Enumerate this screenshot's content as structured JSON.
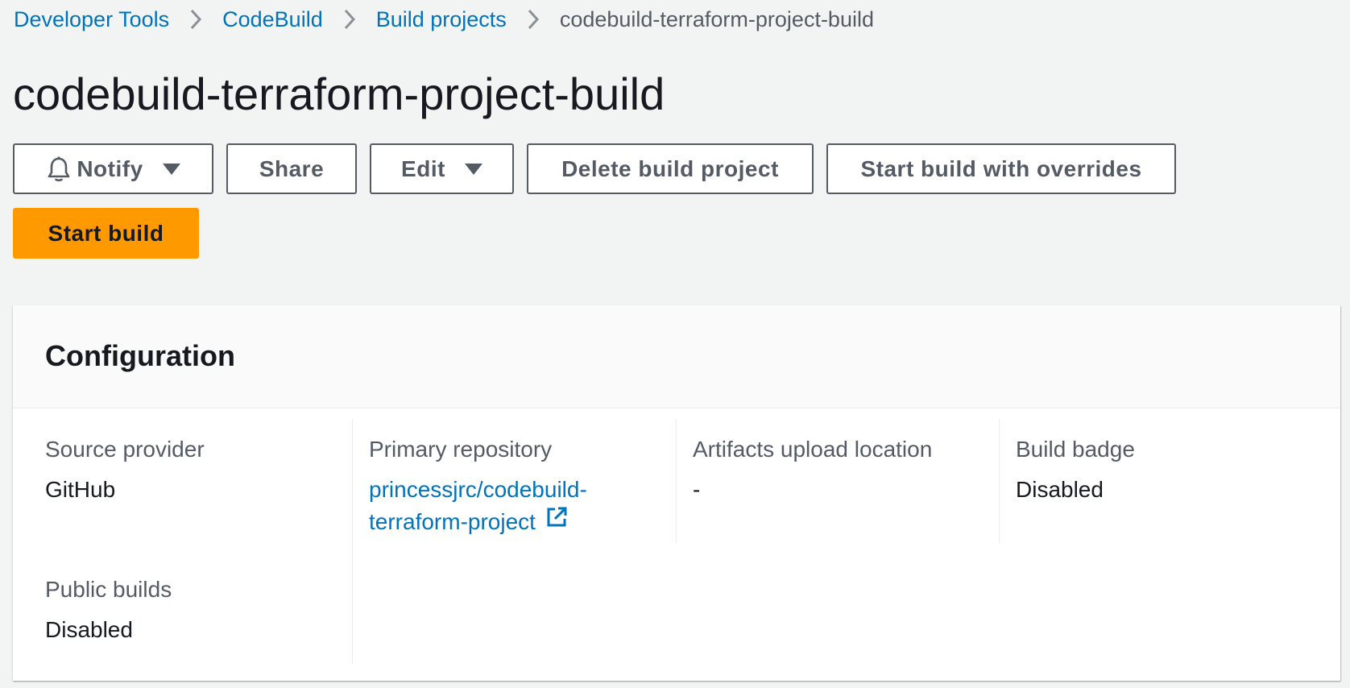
{
  "breadcrumb": {
    "items": [
      {
        "label": "Developer Tools"
      },
      {
        "label": "CodeBuild"
      },
      {
        "label": "Build projects"
      }
    ],
    "current": "codebuild-terraform-project-build"
  },
  "page": {
    "title": "codebuild-terraform-project-build"
  },
  "toolbar": {
    "notify_label": "Notify",
    "share_label": "Share",
    "edit_label": "Edit",
    "delete_label": "Delete build project",
    "start_overrides_label": "Start build with overrides",
    "start_build_label": "Start build"
  },
  "configuration": {
    "title": "Configuration",
    "source_provider": {
      "label": "Source provider",
      "value": "GitHub"
    },
    "primary_repository": {
      "label": "Primary repository",
      "value_line1": "princessjrc/codebuild-",
      "value_line2": "terraform-project"
    },
    "artifacts_upload_location": {
      "label": "Artifacts upload location",
      "value": "-"
    },
    "build_badge": {
      "label": "Build badge",
      "value": "Disabled"
    },
    "public_builds": {
      "label": "Public builds",
      "value": "Disabled"
    }
  },
  "icons": {
    "breadcrumb_separator": "chevron-right-icon",
    "notify": "bell-icon",
    "dropdown": "caret-down-icon",
    "external_link": "external-link-icon"
  },
  "colors": {
    "link": "#0073bb",
    "primary_button": "#ff9900",
    "background": "#f2f3f3",
    "text": "#16191f",
    "secondary_text": "#545b64"
  }
}
